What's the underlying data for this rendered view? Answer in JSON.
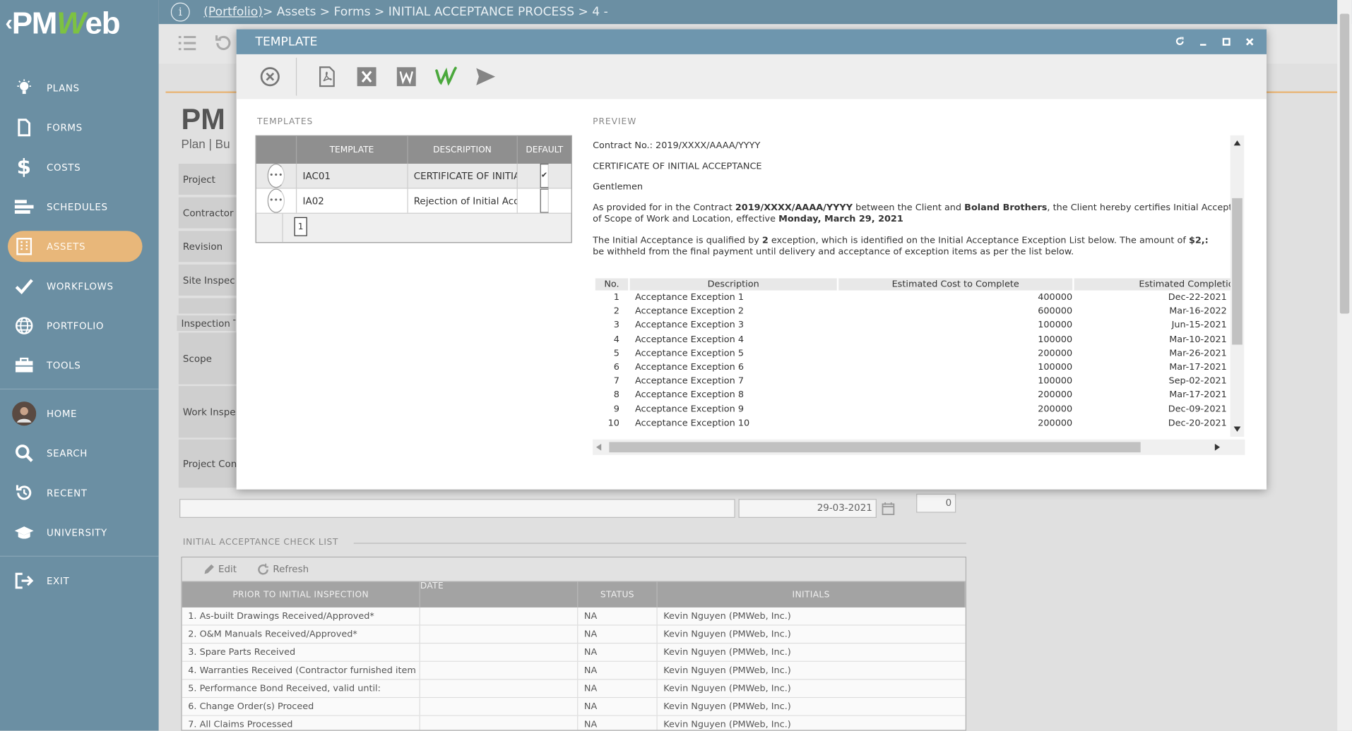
{
  "app": {
    "logo_left": "PM",
    "logo_w": "W",
    "logo_right": "eb"
  },
  "breadcrumb": {
    "portfolio": "(Portfolio)",
    "rest": " > Assets > Forms > INITIAL ACCEPTANCE PROCESS > 4 -"
  },
  "sidebar": {
    "items": [
      {
        "label": "PLANS",
        "icon": "lightbulb-icon"
      },
      {
        "label": "FORMS",
        "icon": "document-icon"
      },
      {
        "label": "COSTS",
        "icon": "dollar-icon"
      },
      {
        "label": "SCHEDULES",
        "icon": "gantt-icon"
      },
      {
        "label": "ASSETS",
        "icon": "building-icon"
      },
      {
        "label": "WORKFLOWS",
        "icon": "checkmark-icon"
      },
      {
        "label": "PORTFOLIO",
        "icon": "globe-icon"
      },
      {
        "label": "TOOLS",
        "icon": "toolbox-icon"
      },
      {
        "label": "HOME",
        "icon": "avatar-icon"
      },
      {
        "label": "SEARCH",
        "icon": "search-icon"
      },
      {
        "label": "RECENT",
        "icon": "history-icon"
      },
      {
        "label": "UNIVERSITY",
        "icon": "graduation-cap-icon"
      },
      {
        "label": "EXIT",
        "icon": "exit-icon"
      }
    ],
    "active": "ASSETS"
  },
  "background_form": {
    "logo": "PM",
    "logo_sub": "Plan | Bu",
    "fields": [
      "Project",
      "Contractor",
      "Revision",
      "Site Inspec",
      "",
      "Inspection T",
      "Scope",
      "Work Inspe",
      "Project Con"
    ],
    "date_value": "29-03-2021",
    "number_value": "0",
    "checklist": {
      "title": "INITIAL ACCEPTANCE CHECK LIST",
      "edit": "Edit",
      "refresh": "Refresh",
      "columns": [
        "PRIOR TO INITIAL INSPECTION",
        "DATE",
        "STATUS",
        "INITIALS"
      ],
      "rows": [
        {
          "item": "1. As-built Drawings Received/Approved*",
          "status": "NA",
          "initials": "Kevin Nguyen (PMWeb, Inc.)"
        },
        {
          "item": "2. O&M Manuals Received/Approved*",
          "status": "NA",
          "initials": "Kevin Nguyen (PMWeb, Inc.)"
        },
        {
          "item": "3. Spare Parts Received",
          "status": "NA",
          "initials": "Kevin Nguyen (PMWeb, Inc.)"
        },
        {
          "item": "4. Warranties Received (Contractor furnished item",
          "status": "NA",
          "initials": "Kevin Nguyen (PMWeb, Inc.)"
        },
        {
          "item": "5. Performance Bond Received, valid until:",
          "status": "NA",
          "initials": "Kevin Nguyen (PMWeb, Inc.)"
        },
        {
          "item": "6. Change Order(s) Proceed",
          "status": "NA",
          "initials": "Kevin Nguyen (PMWeb, Inc.)"
        },
        {
          "item": "7. All Claims Processed",
          "status": "NA",
          "initials": "Kevin Nguyen (PMWeb, Inc.)"
        }
      ]
    }
  },
  "modal": {
    "title": "TEMPLATE",
    "templates_label": "TEMPLATES",
    "preview_label": "PREVIEW",
    "grid": {
      "columns": [
        "TEMPLATE",
        "DESCRIPTION",
        "DEFAULT"
      ],
      "rows": [
        {
          "template": "IAC01",
          "description": "CERTIFICATE OF INITIA",
          "default": true
        },
        {
          "template": "IA02",
          "description": "Rejection of Initial Acc",
          "default": false
        }
      ],
      "page": "1"
    },
    "preview": {
      "contract_line": "Contract No.: 2019/XXXX/AAAA/YYYY",
      "heading": "CERTIFICATE OF INITIAL ACCEPTANCE",
      "salutation": "Gentlemen",
      "p1_a": "As provided for in the Contract ",
      "p1_contract": "2019/XXXX/AAAA/YYYY",
      "p1_b": " between the Client and ",
      "p1_company": "Boland Brothers",
      "p1_c": ", the Client hereby certifies Initial Accept",
      "p1_line2_a": "of Scope of Work and Location, effective ",
      "p1_date": "Monday, March 29, 2021",
      "p2_a": "The Initial Acceptance is qualified by ",
      "p2_count": "2",
      "p2_b": " exception, which is identified on the Initial Acceptance Exception List below. The amount of ",
      "p2_amount": "$2,:",
      "p2_line2": "be withheld from the final payment until delivery and acceptance of exception items as per the list below.",
      "table_columns": [
        "No.",
        "Description",
        "Estimated Cost to Complete",
        "Estimated Completio"
      ],
      "table_rows": [
        {
          "no": "1",
          "desc": "Acceptance Exception 1",
          "cost": "400000",
          "date": "Dec-22-2021"
        },
        {
          "no": "2",
          "desc": "Acceptance Exception 2",
          "cost": "600000",
          "date": "Mar-16-2022"
        },
        {
          "no": "3",
          "desc": "Acceptance Exception 3",
          "cost": "100000",
          "date": "Jun-15-2021"
        },
        {
          "no": "4",
          "desc": "Acceptance Exception 4",
          "cost": "100000",
          "date": "Mar-10-2021"
        },
        {
          "no": "5",
          "desc": "Acceptance Exception 5",
          "cost": "200000",
          "date": "Mar-26-2021"
        },
        {
          "no": "6",
          "desc": "Acceptance Exception 6",
          "cost": "100000",
          "date": "Mar-17-2021"
        },
        {
          "no": "7",
          "desc": "Acceptance Exception 7",
          "cost": "100000",
          "date": "Sep-02-2021"
        },
        {
          "no": "8",
          "desc": "Acceptance Exception 8",
          "cost": "200000",
          "date": "Mar-17-2021"
        },
        {
          "no": "9",
          "desc": "Acceptance Exception 9",
          "cost": "200000",
          "date": "Dec-09-2021"
        },
        {
          "no": "10",
          "desc": "Acceptance Exception 10",
          "cost": "200000",
          "date": "Dec-20-2021"
        }
      ]
    },
    "colors": {
      "titlebar": "#6e96ae",
      "accent_green": "#7dc242",
      "active_nav": "#e8b77a"
    }
  }
}
